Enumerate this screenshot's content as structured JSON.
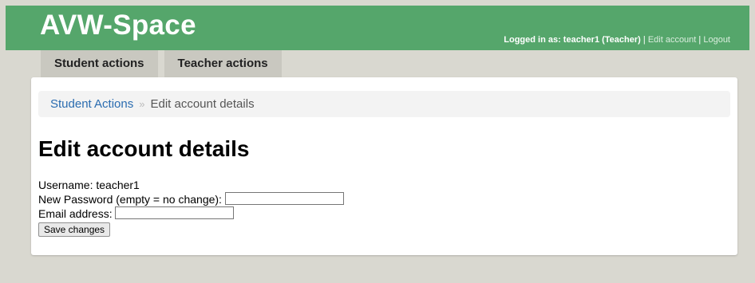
{
  "header": {
    "brand": "AVW-Space",
    "logged_in_text": "Logged in as: teacher1 (Teacher)",
    "separator": "|",
    "edit_account": "Edit account",
    "logout": "Logout"
  },
  "tabs": [
    {
      "label": "Student actions"
    },
    {
      "label": "Teacher actions"
    }
  ],
  "breadcrumb": {
    "parent": "Student Actions",
    "separator": "»",
    "current": "Edit account details"
  },
  "page": {
    "title": "Edit account details"
  },
  "form": {
    "username_label": "Username: teacher1",
    "password_label": "New Password (empty = no change):",
    "password_value": "",
    "email_label": "Email address:",
    "email_value": "",
    "save_label": "Save changes"
  },
  "colors": {
    "header_green": "#55a66b",
    "page_background": "#d9d8d0",
    "link_blue": "#2a6cb0"
  }
}
